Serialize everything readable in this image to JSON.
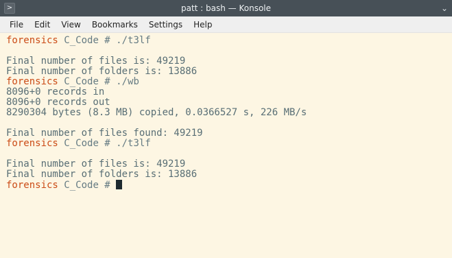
{
  "window": {
    "title": "patt : bash — Konsole",
    "terminal_icon": ">",
    "menu_icon": "chevron-down"
  },
  "menu": {
    "items": [
      {
        "label": "File"
      },
      {
        "label": "Edit"
      },
      {
        "label": "View"
      },
      {
        "label": "Bookmarks"
      },
      {
        "label": "Settings"
      },
      {
        "label": "Help"
      }
    ]
  },
  "colors": {
    "background": "#fdf6e3",
    "prompt_host": "#cb4b16",
    "text": "#586e75"
  },
  "terminal": {
    "lines": [
      {
        "type": "prompt",
        "host": "forensics",
        "path": "C_Code #",
        "cmd": "./t3lf"
      },
      {
        "type": "output",
        "text": ""
      },
      {
        "type": "output",
        "text": "Final number of files is: 49219"
      },
      {
        "type": "output",
        "text": "Final number of folders is: 13886"
      },
      {
        "type": "prompt",
        "host": "forensics",
        "path": "C_Code #",
        "cmd": "./wb"
      },
      {
        "type": "output",
        "text": "8096+0 records in"
      },
      {
        "type": "output",
        "text": "8096+0 records out"
      },
      {
        "type": "output",
        "text": "8290304 bytes (8.3 MB) copied, 0.0366527 s, 226 MB/s"
      },
      {
        "type": "output",
        "text": ""
      },
      {
        "type": "output",
        "text": "Final number of files found: 49219"
      },
      {
        "type": "prompt",
        "host": "forensics",
        "path": "C_Code #",
        "cmd": "./t3lf"
      },
      {
        "type": "output",
        "text": ""
      },
      {
        "type": "output",
        "text": "Final number of files is: 49219"
      },
      {
        "type": "output",
        "text": "Final number of folders is: 13886"
      },
      {
        "type": "prompt",
        "host": "forensics",
        "path": "C_Code #",
        "cmd": "",
        "cursor": true
      }
    ]
  }
}
